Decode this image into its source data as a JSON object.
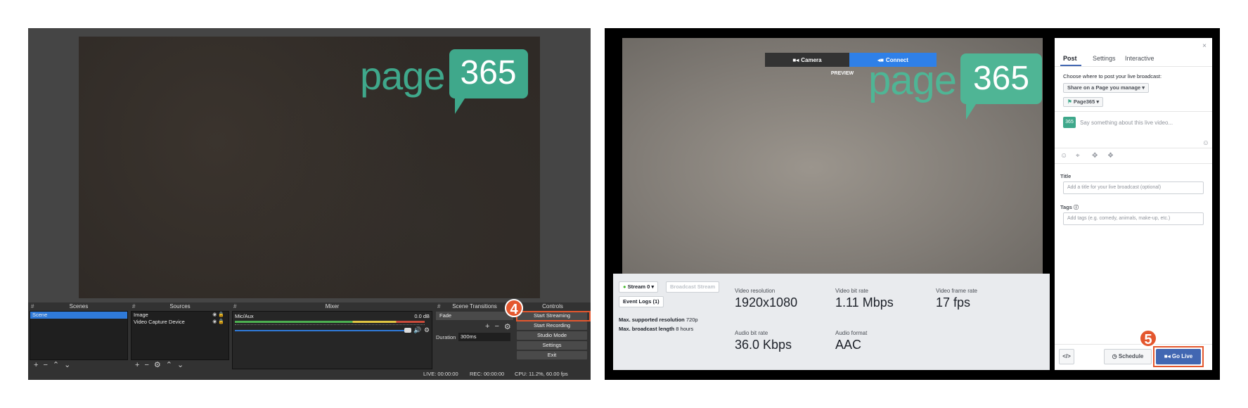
{
  "obs": {
    "logo": {
      "word": "page",
      "number": "365"
    },
    "docks": {
      "scenes": {
        "title": "Scenes",
        "items": [
          "Scene"
        ]
      },
      "sources": {
        "title": "Sources",
        "items": [
          "Image",
          "Video Capture Device"
        ]
      },
      "mixer": {
        "title": "Mixer",
        "channel": "Mic/Aux",
        "level": "0.0 dB"
      },
      "transitions": {
        "title": "Scene Transitions",
        "type": "Fade",
        "duration_label": "Duration",
        "duration_value": "300ms"
      },
      "controls": {
        "title": "Controls",
        "buttons": [
          "Start Streaming",
          "Start Recording",
          "Studio Mode",
          "Settings",
          "Exit"
        ]
      }
    },
    "status": {
      "live": "LIVE: 00:00:00",
      "rec": "REC: 00:00:00",
      "cpu": "CPU: 11.2%, 60.00 fps"
    },
    "step": "4"
  },
  "fb": {
    "toggle": {
      "camera": "Camera",
      "connect": "Connect"
    },
    "preview_label": "PREVIEW",
    "logo": {
      "word": "page",
      "number": "365"
    },
    "stream_select": "Stream 0",
    "broadcast_button": "Broadcast Stream",
    "event_logs": "Event Logs (1)",
    "max_resolution_label": "Max. supported resolution",
    "max_resolution_value": "720p",
    "max_length_label": "Max. broadcast length",
    "max_length_value": "8 hours",
    "stats": [
      {
        "label": "Video resolution",
        "value": "1920x1080"
      },
      {
        "label": "Video bit rate",
        "value": "1.11 Mbps"
      },
      {
        "label": "Video frame rate",
        "value": "17 fps"
      },
      {
        "label": "Audio bit rate",
        "value": "36.0 Kbps"
      },
      {
        "label": "Audio format",
        "value": "AAC"
      }
    ],
    "side": {
      "tabs": [
        "Post",
        "Settings",
        "Interactive"
      ],
      "choose_label": "Choose where to post your live broadcast:",
      "share_select": "Share on a Page you manage",
      "page_select": "Page365",
      "say_placeholder": "Say something about this live video...",
      "avatar_text": "365",
      "title_label": "Title",
      "title_placeholder": "Add a title for your live broadcast (optional)",
      "tags_label": "Tags",
      "tags_placeholder": "Add tags (e.g. comedy, animals, make-up, etc.)",
      "schedule": "Schedule",
      "go_live": "Go Live"
    },
    "step": "5"
  },
  "colors": {
    "obs_highlight": "#e4572e",
    "fb_blue": "#4267b2",
    "logo_green": "#3fa88b"
  }
}
